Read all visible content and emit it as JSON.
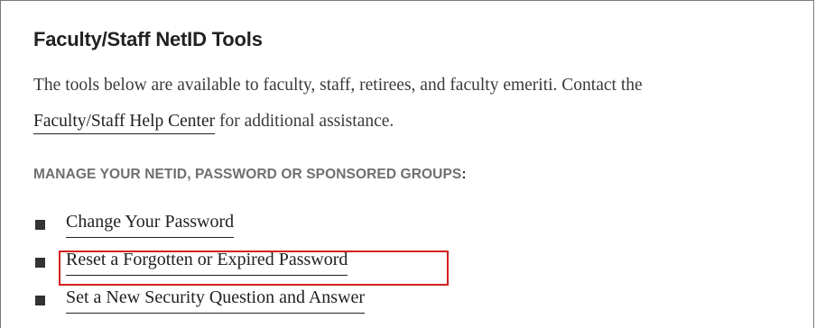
{
  "panel": {
    "title": "Faculty/Staff NetID Tools",
    "intro_text": "The tools below are available to faculty, staff, retirees, and faculty emeriti. Contact the",
    "help_link": "Faculty/Staff Help Center",
    "intro_suffix": " for additional assistance.",
    "section_label": "MANAGE YOUR NETID, PASSWORD OR SPONSORED GROUPS",
    "section_colon": ":"
  },
  "tools": [
    {
      "label": "Change Your Password"
    },
    {
      "label": "Reset a Forgotten or Expired Password"
    },
    {
      "label": "Set a New Security Question and Answer"
    }
  ],
  "colors": {
    "highlight": "#d41f1f",
    "text": "#222222",
    "muted": "#6f6f6f"
  }
}
